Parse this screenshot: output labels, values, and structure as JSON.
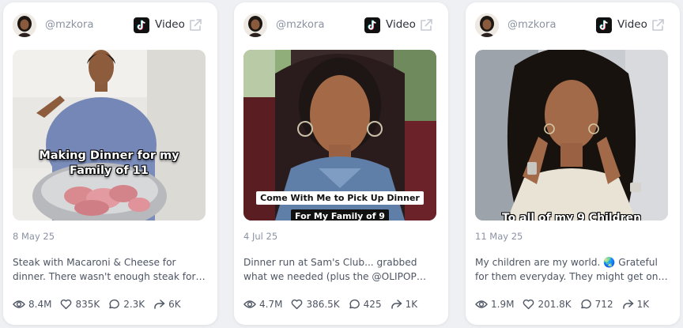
{
  "colors": {
    "page_bg": "#eef0f3",
    "card_bg": "#ffffff",
    "muted_text": "#8a92a2",
    "body_text": "#4e5563"
  },
  "cards": [
    {
      "username": "@mzkora",
      "platform_label": "Video",
      "platform_icon": "tiktok-icon",
      "overlay_text": "Making Dinner for my Family of 11",
      "date": "8 May 25",
      "description": "Steak with Macaroni & Cheese for dinner. There wasn't enough steak for everyone...",
      "stats": {
        "views": "8.4M",
        "likes": "835K",
        "comments": "2.3K",
        "shares": "6K"
      }
    },
    {
      "username": "@mzkora",
      "platform_label": "Video",
      "platform_icon": "tiktok-icon",
      "overlay_line1": "Come With Me to Pick Up Dinner",
      "overlay_line2": "For My Family of 9",
      "date": "4 Jul 25",
      "description": "Dinner run at Sam's Club... grabbed what we needed (plus the @OLIPOP variety...",
      "stats": {
        "views": "4.7M",
        "likes": "386.5K",
        "comments": "425",
        "shares": "1K"
      }
    },
    {
      "username": "@mzkora",
      "platform_label": "Video",
      "platform_icon": "tiktok-icon",
      "overlay_text": "To all of my 9 Children",
      "date": "11 May 25",
      "description": "My children are my world. 🌏 Grateful for them everyday. They might get on my...",
      "stats": {
        "views": "1.9M",
        "likes": "201.8K",
        "comments": "712",
        "shares": "1K"
      }
    }
  ]
}
